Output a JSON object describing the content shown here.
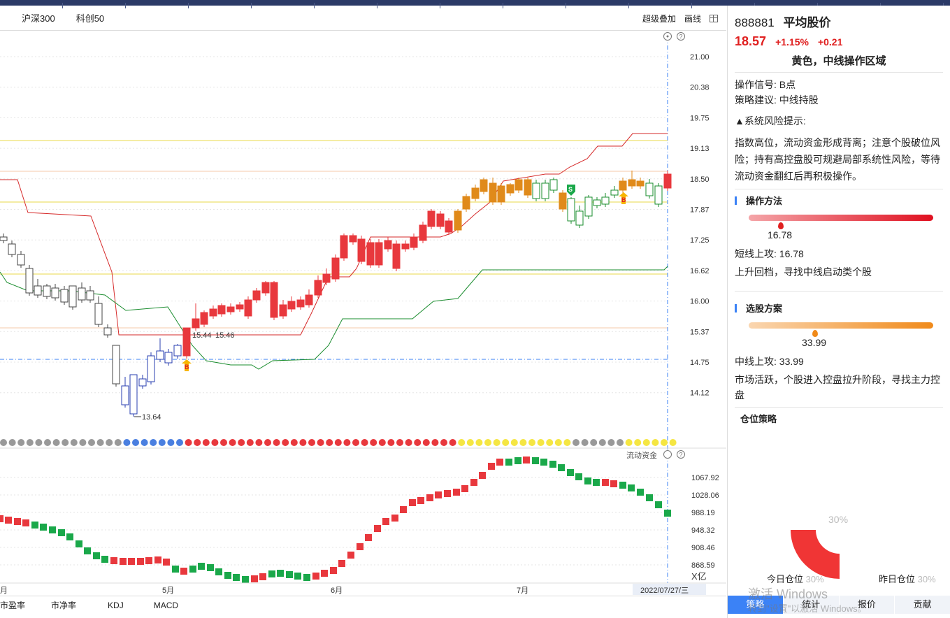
{
  "toolbar": {
    "tabs": [
      "沪深300",
      "科创50"
    ],
    "overlay_label": "超级叠加",
    "draw_label": "画线"
  },
  "main_chart": {
    "y_ticks": [
      "21.00",
      "20.38",
      "19.75",
      "19.13",
      "18.50",
      "17.87",
      "17.25",
      "16.62",
      "16.00",
      "15.37",
      "14.75",
      "14.12"
    ],
    "annotations": {
      "low": "13.64",
      "a": "15.44",
      "b": "15.46"
    },
    "signal_b": "B",
    "signal_s": "S"
  },
  "flow_chart": {
    "title": "流动资金",
    "y_ticks": [
      "1067.92",
      "1028.06",
      "988.19",
      "948.32",
      "908.46",
      "868.59"
    ],
    "unit": "X亿"
  },
  "x_axis": {
    "labels": [
      "5月",
      "6月",
      "7月"
    ],
    "edge_label": "月",
    "cursor_date": "2022/07/27/三"
  },
  "bottom_tabs": [
    "市盈率",
    "市净率",
    "KDJ",
    "MACD"
  ],
  "panel": {
    "code": "888881",
    "name": "平均股价",
    "price": "18.57",
    "change_pct": "+1.15%",
    "change_abs": "+0.21",
    "zone": "黄色，中线操作区域",
    "signal_label": "操作信号: B点",
    "advice_label": "策略建议: 中线持股",
    "risk_title": "▲系统风险提示:",
    "risk_text": "指数高位，流动资金形成背离；注意个股破位风险；持有高控盘股可规避局部系统性风险，等待流动资金翻红后再积极操作。",
    "method_title": "操作方法",
    "method_value": "16.78",
    "short_line": "短线上攻: 16.78",
    "short_desc": "上升回档，寻找中线启动类个股",
    "pick_title": "选股方案",
    "pick_value": "33.99",
    "mid_line": "中线上攻: 33.99",
    "mid_desc": "市场活跃，个股进入控盘拉升阶段，寻找主力控盘",
    "position_title": "仓位策略",
    "position_pct": "30%",
    "today_label": "今日仓位",
    "today_value": "30%",
    "yesterday_label": "昨日仓位",
    "yesterday_value": "30%",
    "tabs": [
      "策略",
      "统计",
      "报价",
      "贡献"
    ],
    "watermark1": "激活 Windows",
    "watermark2": "转到\"设置\"以激活 Windows。"
  },
  "colors": {
    "up": "#e8383d",
    "down_hollow": "#1a8c2e",
    "yellow_candle": "#e08a1a",
    "accent": "#3b82f6"
  }
}
